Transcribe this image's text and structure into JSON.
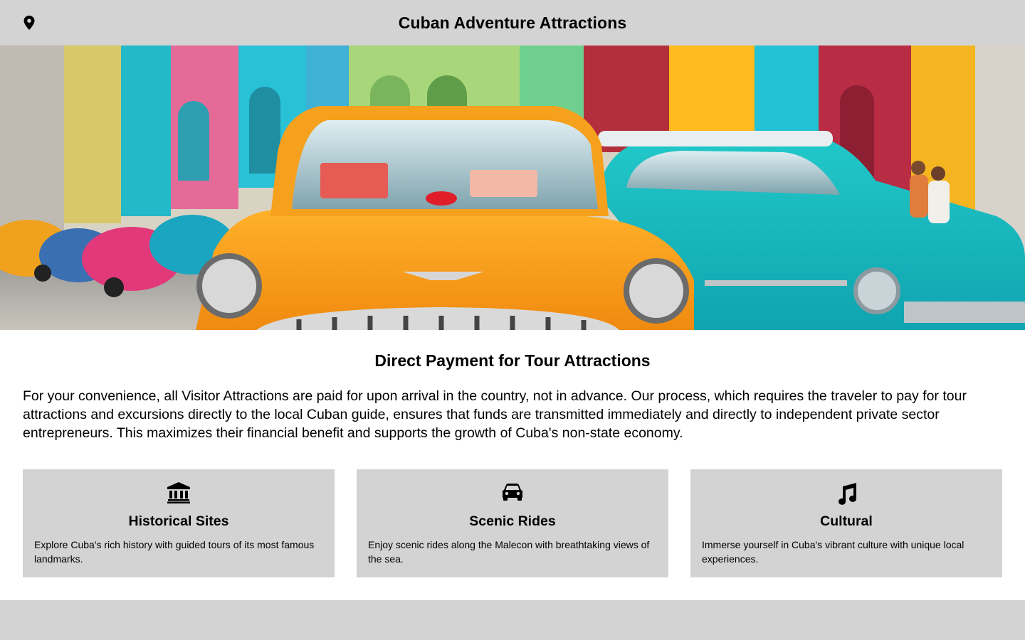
{
  "header": {
    "title": "Cuban Adventure Attractions",
    "location_icon": "map-pin-icon"
  },
  "hero": {
    "image": "classic-cars-havana-street"
  },
  "main": {
    "heading": "Direct Payment for Tour Attractions",
    "paragraph": "For your convenience, all Visitor Attractions are paid for upon arrival in the country, not in advance. Our process, which requires the traveler to pay for tour attractions and excursions directly to the local Cuban guide, ensures that funds are transmitted immediately and directly to independent private sector entrepreneurs. This maximizes their financial benefit and supports the growth of Cuba's non-state economy."
  },
  "cards": [
    {
      "icon": "landmark-icon",
      "title": "Historical Sites",
      "description": "Explore Cuba's rich history with guided tours of its most famous landmarks."
    },
    {
      "icon": "car-icon",
      "title": "Scenic Rides",
      "description": "Enjoy scenic rides along the Malecon with breathtaking views of the sea."
    },
    {
      "icon": "music-note-icon",
      "title": "Cultural",
      "description": "Immerse yourself in Cuba's vibrant culture with unique local experiences."
    }
  ],
  "colors": {
    "bar_background": "#d3d3d3",
    "page_background": "#ffffff",
    "text": "#000000"
  }
}
